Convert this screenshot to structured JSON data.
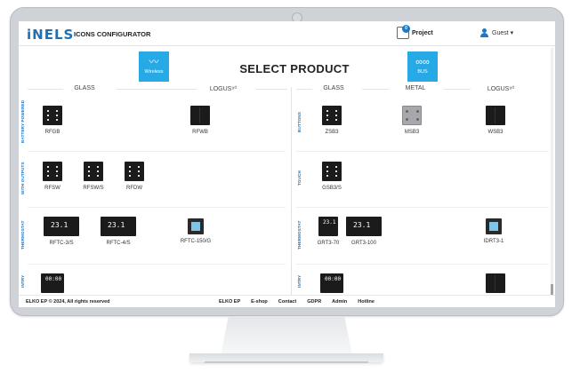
{
  "header": {
    "logo": "iNELS",
    "title": "ICONS CONFIGURATOR",
    "project_label": "Project",
    "project_count": "0",
    "user_label": "Guest ▾"
  },
  "page": {
    "heading": "SELECT PRODUCT",
    "wireless_label": "Wireless",
    "bus_label": "BUS"
  },
  "columns": {
    "left": [
      "GLASS",
      "LOGUS⁹⁰"
    ],
    "right": [
      "GLASS",
      "METAL",
      "LOGUS⁹⁰"
    ]
  },
  "sections": {
    "left": [
      "BATTERY POWERED",
      "WITH OUTPUTS",
      "THERMOSTAT",
      "INTRY"
    ],
    "right": [
      "BUTTONS",
      "TOUCH",
      "THERMOSTAT",
      "INTRY"
    ]
  },
  "products": {
    "rfgb": "RFGB",
    "rfwb": "RFWB",
    "rfsw": "RFSW",
    "rfsws": "RFSW/S",
    "rfdw": "RFDW",
    "rftc3": "RFTC-3/S",
    "rftc4": "RFTC-4/S",
    "rftc150": "RFTC-150/G",
    "zsb3": "ZSB3",
    "msb3": "MSB3",
    "wsb3": "WSB3",
    "gsb3": "GSB3/S",
    "grt70": "GRT3-70",
    "grt100": "GRT3-100",
    "idrt": "IDRT3-1",
    "therm_readout": "23.1",
    "intry_readout": "00:00"
  },
  "footer": {
    "copyright": "ELKO EP © 2024, All rights reserved",
    "links": [
      "ELKO EP",
      "E-shop",
      "Contact",
      "GDPR",
      "Admin",
      "Hotline"
    ]
  },
  "colors": {
    "accent": "#27a9e6",
    "brand_blue": "#1f6fb2"
  }
}
